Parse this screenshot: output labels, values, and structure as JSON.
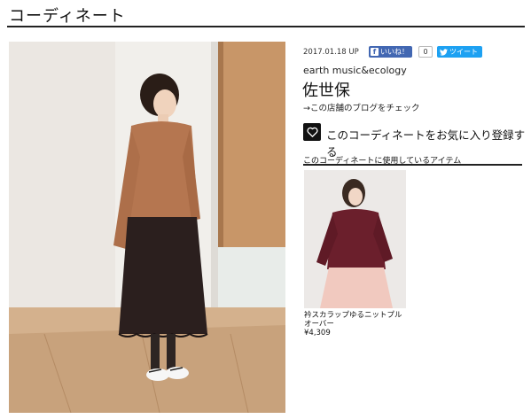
{
  "header": {
    "title": "コーディネート"
  },
  "post": {
    "date": "2017.01.18 UP",
    "facebook": {
      "label": "いいね！",
      "count": "0"
    },
    "twitter": {
      "label": "ツイート"
    },
    "brand": "earth music&ecology",
    "shop": "佐世保",
    "shop_link": "→この店舗のブログをチェック",
    "favorite_label": "このコーディネートをお気に入り登録する",
    "favorite_icon": "heart-icon"
  },
  "items_section": {
    "heading": "このコーディネートに使用しているアイテム",
    "items": [
      {
        "name": "衿スカラップゆるニットプルオーバー",
        "price": "¥4,309"
      }
    ]
  },
  "colors": {
    "facebook": "#4267b2",
    "twitter": "#1da1f2",
    "sweater_main": "#b57650",
    "sweater_item": "#6b1f2c"
  }
}
